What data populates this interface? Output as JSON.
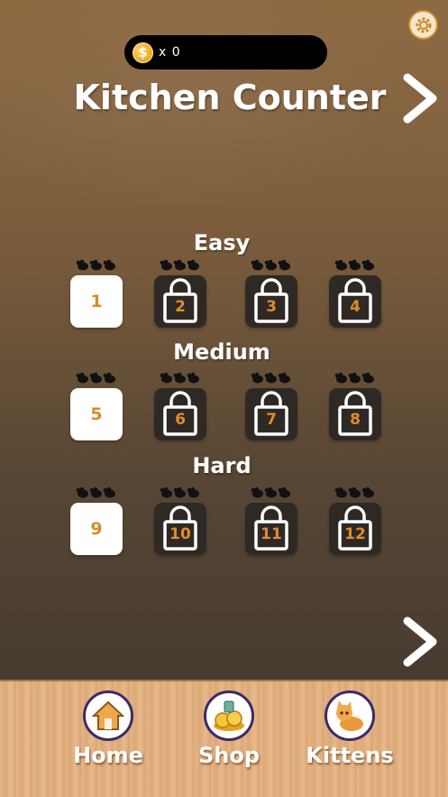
{
  "header": {
    "coin_symbol": "$",
    "coin_count": "x 0",
    "title": "Kitchen Counter",
    "settings_icon": "gear-icon",
    "next_icon": "chevron-right-icon"
  },
  "sections": [
    {
      "label": "Easy",
      "levels": [
        {
          "number": "1",
          "locked": false,
          "mice_earned": 0
        },
        {
          "number": "2",
          "locked": true,
          "mice_earned": 0
        },
        {
          "number": "3",
          "locked": true,
          "mice_earned": 0
        },
        {
          "number": "4",
          "locked": true,
          "mice_earned": 0
        }
      ]
    },
    {
      "label": "Medium",
      "levels": [
        {
          "number": "5",
          "locked": false,
          "mice_earned": 0
        },
        {
          "number": "6",
          "locked": true,
          "mice_earned": 0
        },
        {
          "number": "7",
          "locked": true,
          "mice_earned": 0
        },
        {
          "number": "8",
          "locked": true,
          "mice_earned": 0
        }
      ]
    },
    {
      "label": "Hard",
      "levels": [
        {
          "number": "9",
          "locked": false,
          "mice_earned": 0
        },
        {
          "number": "10",
          "locked": true,
          "mice_earned": 0
        },
        {
          "number": "11",
          "locked": true,
          "mice_earned": 0
        },
        {
          "number": "12",
          "locked": true,
          "mice_earned": 0
        }
      ]
    }
  ],
  "nav": {
    "home": {
      "label": "Home",
      "icon": "house-icon"
    },
    "shop": {
      "label": "Shop",
      "icon": "coin-pile-icon"
    },
    "kittens": {
      "label": "Kittens",
      "icon": "kitten-icon"
    }
  },
  "colors": {
    "level_number": "#d9892c",
    "coin": "#f1a91f",
    "nav_border": "#3b2a6a"
  }
}
